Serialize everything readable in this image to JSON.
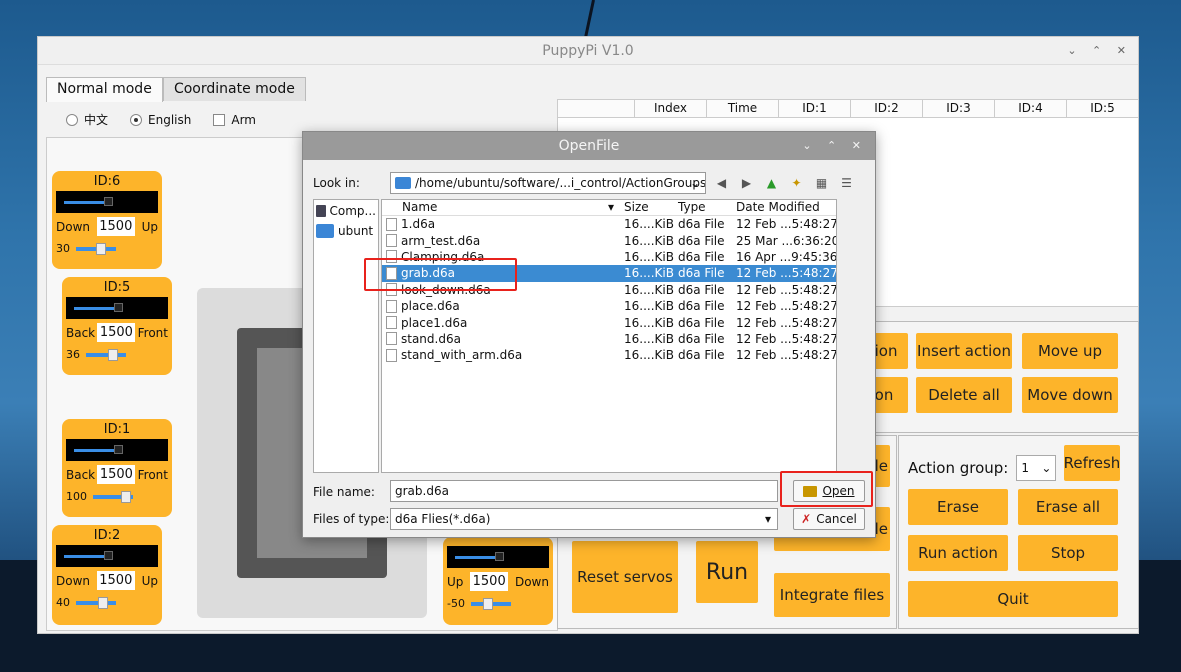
{
  "app": {
    "title": "PuppyPi V1.0",
    "controls": "⌄ ⌃ ✕"
  },
  "tabs": [
    "Normal mode",
    "Coordinate mode"
  ],
  "lang": {
    "zh": "中文",
    "en": "English",
    "arm": "Arm"
  },
  "servos": [
    {
      "id": "ID:6",
      "left": "Down",
      "value": "1500",
      "right": "Up",
      "mini": "30",
      "level": 0.4
    },
    {
      "id": "ID:5",
      "left": "Back",
      "value": "1500",
      "right": "Front",
      "mini": "36",
      "level": 0.45
    },
    {
      "id": "ID:1",
      "left": "Back",
      "value": "1500",
      "right": "Front",
      "mini": "100",
      "level": 0.6
    },
    {
      "id": "ID:2",
      "left": "Down",
      "value": "1500",
      "right": "Up",
      "mini": "40",
      "level": 0.45
    },
    {
      "id": "",
      "left": "Up",
      "value": "1500",
      "right": "Down",
      "mini": "-50",
      "level": 0.3
    }
  ],
  "table_headers": [
    "",
    "Index",
    "Time",
    "ID:1",
    "ID:2",
    "ID:3",
    "ID:4",
    "ID:5"
  ],
  "buttons": {
    "action1": "ction",
    "action2": "tion",
    "insert": "Insert action",
    "moveup": "Move up",
    "deleteall": "Delete all",
    "movedown": "Move down",
    "le1": "le",
    "le2": "le",
    "reset": "Reset servos",
    "run": "Run",
    "integrate": "Integrate files",
    "refresh": "Refresh",
    "erase": "Erase",
    "eraseall": "Erase all",
    "runaction": "Run action",
    "stop": "Stop",
    "quit": "Quit"
  },
  "action_group": {
    "label": "Action group:",
    "value": "1"
  },
  "dialog": {
    "title": "OpenFile",
    "controls": "⌄ ⌃ ✕",
    "look_in_label": "Look in:",
    "path": "/home/ubuntu/software/...i_control/ActionGroups",
    "nav_icons": [
      "back-icon",
      "forward-icon",
      "up-icon",
      "new-folder-icon",
      "list-view-icon",
      "detail-view-icon"
    ],
    "sidebar": [
      "Comp...",
      "ubunt"
    ],
    "headers": [
      "Name",
      "Size",
      "Type",
      "Date Modified"
    ],
    "files": [
      {
        "name": "1.d6a",
        "size": "16....KiB",
        "type": "d6a File",
        "date": "12 Feb ...5:48:27"
      },
      {
        "name": "arm_test.d6a",
        "size": "16....KiB",
        "type": "d6a File",
        "date": "25 Mar ...6:36:20"
      },
      {
        "name": "Clamping.d6a",
        "size": "16....KiB",
        "type": "d6a File",
        "date": "16 Apr ...9:45:36"
      },
      {
        "name": "grab.d6a",
        "size": "16....KiB",
        "type": "d6a File",
        "date": "12 Feb ...5:48:27"
      },
      {
        "name": "look_down.d6a",
        "size": "16....KiB",
        "type": "d6a File",
        "date": "12 Feb ...5:48:27"
      },
      {
        "name": "place.d6a",
        "size": "16....KiB",
        "type": "d6a File",
        "date": "12 Feb ...5:48:27"
      },
      {
        "name": "place1.d6a",
        "size": "16....KiB",
        "type": "d6a File",
        "date": "12 Feb ...5:48:27"
      },
      {
        "name": "stand.d6a",
        "size": "16....KiB",
        "type": "d6a File",
        "date": "12 Feb ...5:48:27"
      },
      {
        "name": "stand_with_arm.d6a",
        "size": "16....KiB",
        "type": "d6a File",
        "date": "12 Feb ...5:48:27"
      }
    ],
    "selected_index": 3,
    "filename_label": "File name:",
    "filename": "grab.d6a",
    "filetype_label": "Files of type:",
    "filetype": "d6a Flies(*.d6a)",
    "open": "Open",
    "cancel": "Cancel"
  }
}
